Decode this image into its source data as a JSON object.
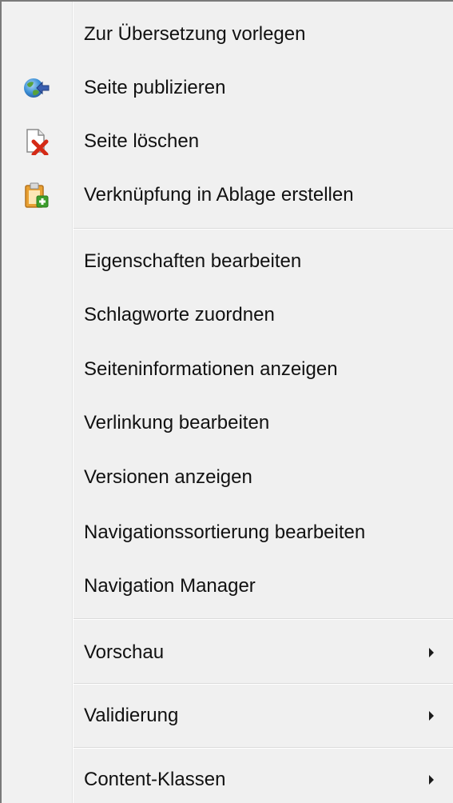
{
  "menu": {
    "items": [
      {
        "label": "Zur Übersetzung vorlegen",
        "icon": ""
      },
      {
        "label": "Seite publizieren",
        "icon": "globe-publish-icon"
      },
      {
        "label": "Seite löschen",
        "icon": "delete-page-icon"
      },
      {
        "label": "Verknüpfung in Ablage erstellen",
        "icon": "clipboard-add-icon"
      },
      {
        "label": "Eigenschaften bearbeiten"
      },
      {
        "label": "Schlagworte zuordnen"
      },
      {
        "label": "Seiteninformationen anzeigen"
      },
      {
        "label": "Verlinkung bearbeiten"
      },
      {
        "label": "Versionen anzeigen"
      },
      {
        "label": "Navigationssortierung bearbeiten"
      },
      {
        "label": "Navigation Manager"
      },
      {
        "label": "Vorschau",
        "submenu": true
      },
      {
        "label": "Validierung",
        "submenu": true
      },
      {
        "label": "Content-Klassen",
        "submenu": true
      }
    ]
  },
  "colors": {
    "background": "#f0f0f0",
    "border": "#7a7a7a",
    "text": "#111111",
    "separator": "#dadada",
    "delete_red": "#d42a16",
    "clipboard_orange": "#e8a032",
    "add_green": "#3c9e2c",
    "globe_blue": "#3a6fb0"
  }
}
